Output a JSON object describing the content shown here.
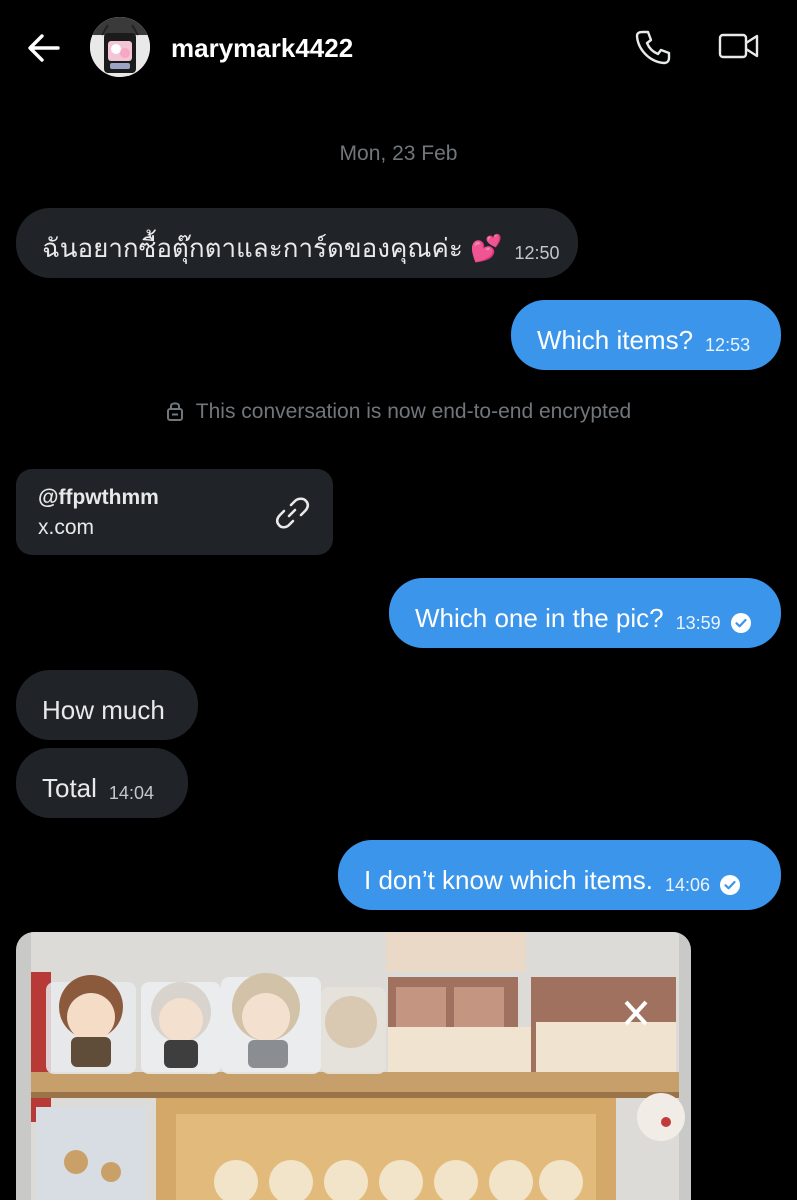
{
  "header": {
    "username": "marymark4422"
  },
  "date_separator": "Mon, 23 Feb",
  "messages": [
    {
      "text": "ฉันอยากซื้อตุ๊กตาและการ์ดของคุณค่ะ 💕",
      "time": "12:50",
      "direction": "incoming"
    },
    {
      "text": "Which items?",
      "time": "12:53",
      "direction": "outgoing"
    },
    {
      "text": "Which one in the pic?",
      "time": "13:59",
      "direction": "outgoing",
      "read": true
    },
    {
      "text": "How much",
      "time": "",
      "direction": "incoming"
    },
    {
      "text": "Total",
      "time": "14:04",
      "direction": "incoming"
    },
    {
      "text": "I don’t know which items.",
      "time": "14:06",
      "direction": "outgoing",
      "read": true
    }
  ],
  "encryption_notice": "This conversation is now end-to-end encrypted",
  "link_card": {
    "handle": "@ffpwthmm",
    "domain": "x.com"
  },
  "colors": {
    "background": "#000000",
    "incoming_bubble": "#202327",
    "outgoing_bubble": "#3b95ea",
    "muted_text": "#71767b"
  },
  "icons": [
    "back-arrow-icon",
    "phone-icon",
    "video-camera-icon",
    "lock-icon",
    "link-icon",
    "read-check-icon"
  ]
}
